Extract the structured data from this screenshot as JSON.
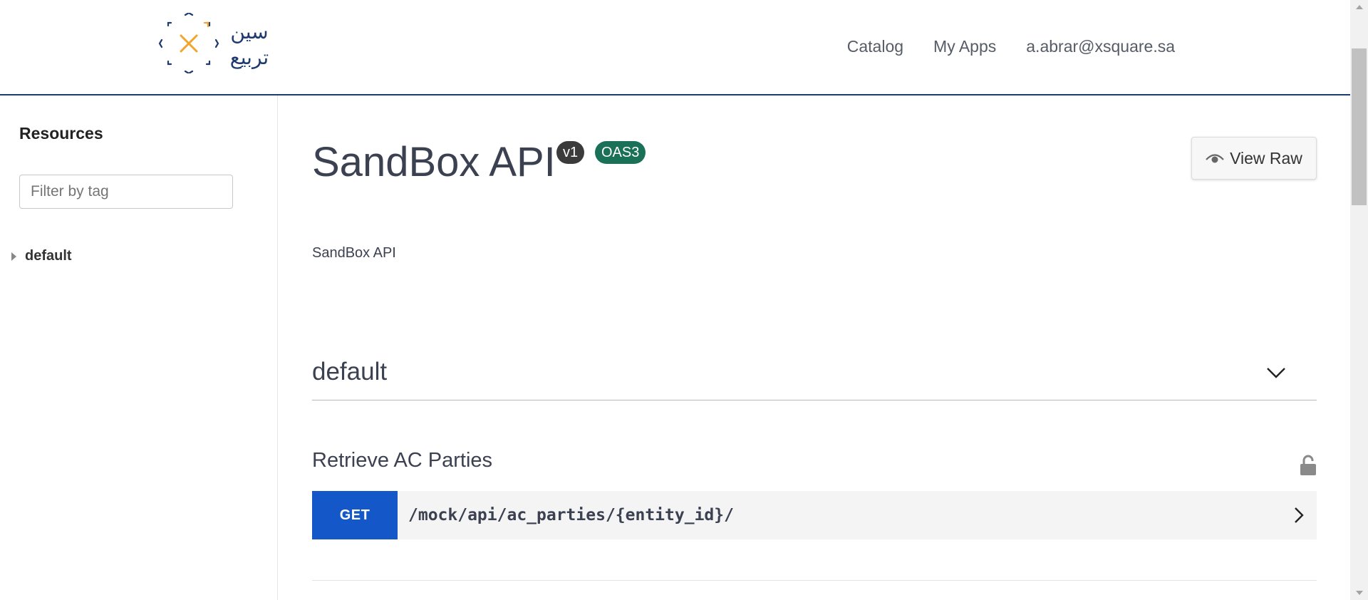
{
  "header": {
    "logo_text": "سين تربيع",
    "nav": {
      "catalog": "Catalog",
      "my_apps": "My Apps",
      "user_email": "a.abrar@xsquare.sa"
    }
  },
  "sidebar": {
    "title": "Resources",
    "filter_placeholder": "Filter by tag",
    "tags": [
      {
        "label": "default"
      }
    ]
  },
  "main": {
    "title": "SandBox API",
    "version_badge": "v1",
    "spec_badge": "OAS3",
    "view_raw_label": "View Raw",
    "description": "SandBox API",
    "section": {
      "name": "default",
      "operation": {
        "summary": "Retrieve AC Parties",
        "method": "GET",
        "path": "/mock/api/ac_parties/{entity_id}/"
      }
    }
  },
  "colors": {
    "accent_blue": "#1457c9",
    "header_border": "#1e3a6e",
    "oas_badge": "#1a7157",
    "version_badge": "#3b3b3b",
    "logo_orange": "#f2a52c",
    "logo_navy": "#1e3a6e"
  },
  "icons": {
    "logo": "xsquare-logo",
    "view_raw": "eye-icon",
    "section_toggle": "chevron-down-icon",
    "auth": "lock-icon",
    "expand_operation": "chevron-right-icon",
    "tag_expand": "caret-right-icon"
  }
}
